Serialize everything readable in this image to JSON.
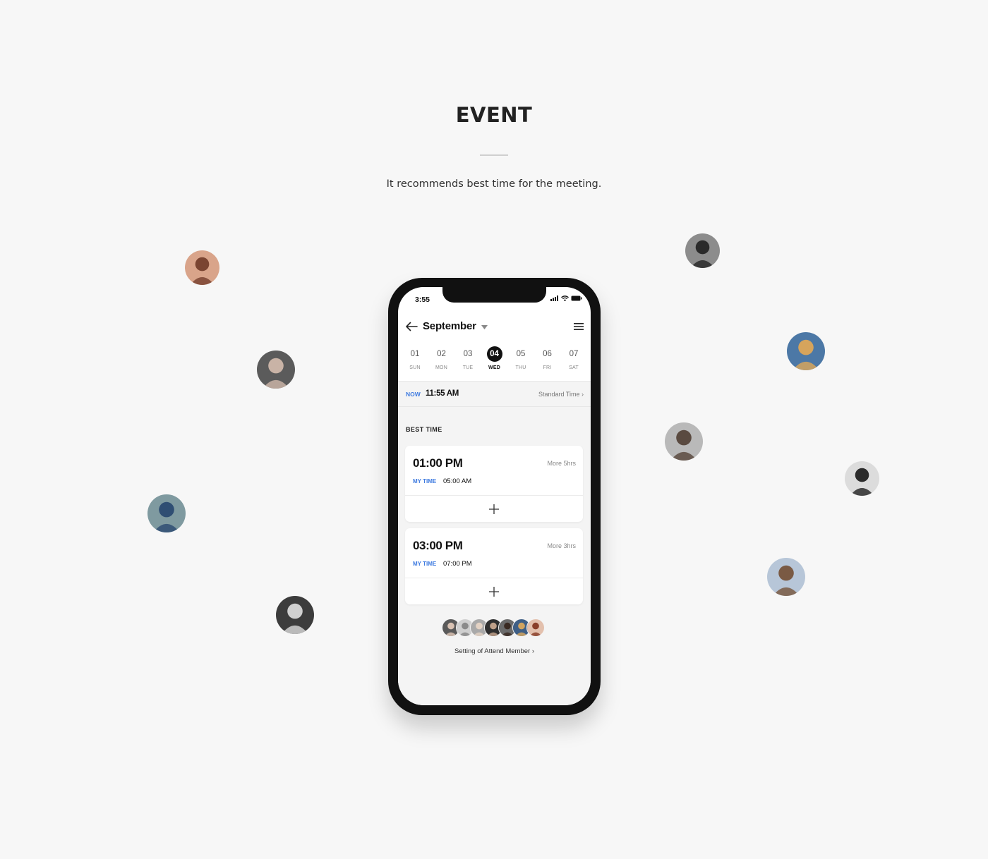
{
  "hero": {
    "title": "EVENT",
    "subtitle": "It recommends best time for the meeting."
  },
  "floating_avatars": [
    {
      "name": "avatar-glasses-woman",
      "bg": "#d9a48a",
      "fg": "#7a4431"
    },
    {
      "name": "avatar-dark-woman",
      "bg": "#5b5b5b",
      "fg": "#c9b3a6"
    },
    {
      "name": "avatar-blue-jacket",
      "bg": "#7f9aa0",
      "fg": "#2f4e73"
    },
    {
      "name": "avatar-bw-street",
      "bg": "#3c3c3c",
      "fg": "#d0d0d0"
    },
    {
      "name": "avatar-hood-woman",
      "bg": "#8c8c8c",
      "fg": "#2a2a2a"
    },
    {
      "name": "avatar-blue-sky",
      "bg": "#4c78a6",
      "fg": "#d6a45c"
    },
    {
      "name": "avatar-couple",
      "bg": "#b9b9b9",
      "fg": "#5a4a40"
    },
    {
      "name": "avatar-cap-man",
      "bg": "#dcdcdc",
      "fg": "#2b2b2b"
    },
    {
      "name": "avatar-back-woman",
      "bg": "#b7c6d8",
      "fg": "#7a5a44"
    }
  ],
  "phone": {
    "status": {
      "time": "3:55"
    },
    "nav": {
      "month": "September"
    },
    "days": [
      {
        "num": "01",
        "name": "SUN",
        "active": false
      },
      {
        "num": "02",
        "name": "MON",
        "active": false
      },
      {
        "num": "03",
        "name": "TUE",
        "active": false
      },
      {
        "num": "04",
        "name": "WED",
        "active": true
      },
      {
        "num": "05",
        "name": "THU",
        "active": false
      },
      {
        "num": "06",
        "name": "FRI",
        "active": false
      },
      {
        "num": "07",
        "name": "SAT",
        "active": false
      }
    ],
    "now": {
      "label": "NOW",
      "time": "11:55 AM",
      "standard": "Standard Time"
    },
    "best_time": {
      "label": "BEST TIME",
      "slots": [
        {
          "time": "01:00 PM",
          "more": "More 5hrs",
          "my_label": "MY TIME",
          "my_time": "05:00 AM"
        },
        {
          "time": "03:00 PM",
          "more": "More 3hrs",
          "my_label": "MY TIME",
          "my_time": "07:00 PM"
        }
      ]
    },
    "members": [
      {
        "bg": "#5a5a5a",
        "fg": "#d9c2b3"
      },
      {
        "bg": "#cfcfcf",
        "fg": "#8a8a8a"
      },
      {
        "bg": "#a9a9a9",
        "fg": "#e3d2c4"
      },
      {
        "bg": "#2f2f2f",
        "fg": "#bfa089"
      },
      {
        "bg": "#6b6b6b",
        "fg": "#3a2a22"
      },
      {
        "bg": "#3f5f86",
        "fg": "#d2a460"
      },
      {
        "bg": "#e3c0ad",
        "fg": "#8a3f2a"
      }
    ],
    "attend_link": "Setting of Attend Member"
  },
  "colors": {
    "accent": "#3f7be0",
    "phone_frame": "#111111",
    "page_bg": "#f7f7f7"
  }
}
